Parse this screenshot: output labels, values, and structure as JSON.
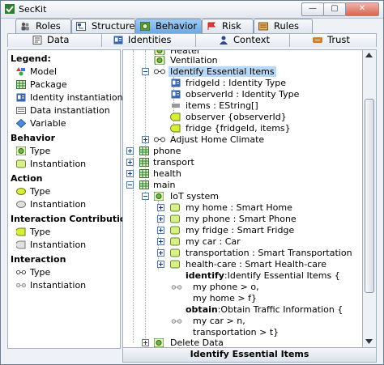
{
  "window": {
    "title": "SecKit",
    "controls": [
      "—",
      "▢",
      "✕"
    ]
  },
  "tabs_main": [
    {
      "label": "Roles",
      "icon": "roles-icon",
      "selected": false
    },
    {
      "label": "Structure",
      "icon": "structure-icon",
      "selected": false
    },
    {
      "label": "Behavior",
      "icon": "behavior-icon",
      "selected": true
    },
    {
      "label": "Risk",
      "icon": "risk-icon",
      "selected": false
    },
    {
      "label": "Rules",
      "icon": "rules-icon",
      "selected": false
    }
  ],
  "tabs_context": [
    {
      "label": "Data",
      "icon": "data-icon"
    },
    {
      "label": "Identities",
      "icon": "identities-icon"
    },
    {
      "label": "Context",
      "icon": "context-icon"
    },
    {
      "label": "Trust",
      "icon": "trust-icon"
    }
  ],
  "legend": {
    "title": "Legend:",
    "groups": [
      {
        "items": [
          {
            "label": "Model",
            "icon": "model-icon"
          },
          {
            "label": "Package",
            "icon": "package-icon"
          },
          {
            "label": "Identity instantiation",
            "icon": "identity-instantiation-icon"
          },
          {
            "label": "Data instantiation",
            "icon": "data-instantiation-icon"
          },
          {
            "label": "Variable",
            "icon": "variable-icon"
          }
        ]
      },
      {
        "heading": "Behavior",
        "items": [
          {
            "label": "Type",
            "icon": "behavior-type-icon"
          },
          {
            "label": "Instantiation",
            "icon": "behavior-instantiation-icon"
          }
        ]
      },
      {
        "heading": "Action",
        "items": [
          {
            "label": "Type",
            "icon": "action-type-icon"
          },
          {
            "label": "Instantiation",
            "icon": "action-instantiation-icon"
          }
        ]
      },
      {
        "heading": "Interaction Contribution",
        "items": [
          {
            "label": "Type",
            "icon": "interaction-contribution-type-icon"
          },
          {
            "label": "Instantiation",
            "icon": "interaction-contribution-instantiation-icon"
          }
        ]
      },
      {
        "heading": "Interaction",
        "items": [
          {
            "label": "Type",
            "icon": "interaction-type-icon"
          },
          {
            "label": "Instantiation",
            "icon": "interaction-instantiation-icon"
          }
        ]
      }
    ]
  },
  "tree": {
    "nodes": [
      {
        "label": "Heater",
        "icon": "behavior-type-icon",
        "expander": "none"
      },
      {
        "label": "Ventilation",
        "icon": "behavior-type-icon",
        "expander": "none"
      },
      {
        "label": "Identify Essential Items",
        "icon": "interaction-type-icon",
        "expander": "minus",
        "selected": true
      },
      {
        "label": "fridgeId : Identity Type",
        "icon": "identity-instantiation-icon",
        "expander": "none"
      },
      {
        "label": "observerId : Identity Type",
        "icon": "identity-instantiation-icon",
        "expander": "none"
      },
      {
        "label": "items : EString[]",
        "icon": "data-instantiation-icon",
        "expander": "none"
      },
      {
        "label": "observer {observerId}",
        "icon": "interaction-contribution-type-icon",
        "expander": "none"
      },
      {
        "label": "fridge {fridgeId, items}",
        "icon": "interaction-contribution-type-icon",
        "expander": "none"
      },
      {
        "label": "Adjust Home Climate",
        "icon": "interaction-type-icon",
        "expander": "plus"
      },
      {
        "label": "phone",
        "icon": "package-icon",
        "expander": "plus"
      },
      {
        "label": "transport",
        "icon": "package-icon",
        "expander": "plus"
      },
      {
        "label": "health",
        "icon": "package-icon",
        "expander": "plus"
      },
      {
        "label": "main",
        "icon": "package-icon",
        "expander": "minus"
      },
      {
        "label": "IoT system",
        "icon": "behavior-type-icon",
        "expander": "minus"
      },
      {
        "label": "my home : Smart Home",
        "icon": "behavior-instantiation-icon",
        "expander": "plus"
      },
      {
        "label": "my phone : Smart Phone",
        "icon": "behavior-instantiation-icon",
        "expander": "plus"
      },
      {
        "label": "my fridge : Smart Fridge",
        "icon": "behavior-instantiation-icon",
        "expander": "plus"
      },
      {
        "label": "my car : Car",
        "icon": "behavior-instantiation-icon",
        "expander": "plus"
      },
      {
        "label": "transportation : Smart Transportation",
        "icon": "behavior-instantiation-icon",
        "expander": "plus"
      },
      {
        "label": "health-care : Smart Health-care",
        "icon": "behavior-instantiation-icon",
        "expander": "plus"
      }
    ],
    "interactions": [
      {
        "keyword": "identify",
        "head": ":Identify Essential Items {",
        "lines": [
          "my phone > o,",
          "my home > f}"
        ]
      },
      {
        "keyword": "obtain",
        "head": ":Obtain Traffic Information {",
        "lines": [
          "my car > n,",
          "transportation > t}"
        ]
      }
    ],
    "last_node": {
      "label": "Delete Data",
      "icon": "behavior-type-icon",
      "expander": "plus"
    }
  },
  "status": {
    "text": "Identify Essential Items"
  }
}
